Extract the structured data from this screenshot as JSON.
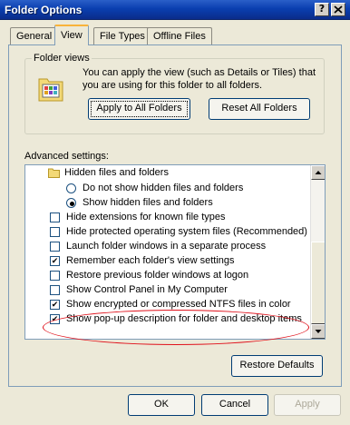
{
  "window": {
    "title": "Folder Options",
    "help_button": "?",
    "close_button": "X"
  },
  "tabs": [
    {
      "label": "General",
      "active": false
    },
    {
      "label": "View",
      "active": true
    },
    {
      "label": "File Types",
      "active": false
    },
    {
      "label": "Offline Files",
      "active": false
    }
  ],
  "folder_views": {
    "legend": "Folder views",
    "description": "You can apply the view (such as Details or Tiles) that you are using for this folder to all folders.",
    "apply_button": "Apply to All Folders",
    "reset_button": "Reset All Folders"
  },
  "advanced": {
    "label": "Advanced settings:",
    "items": [
      {
        "type": "folder",
        "label": "Hidden files and folders"
      },
      {
        "type": "radio",
        "label": "Do not show hidden files and folders",
        "checked": false
      },
      {
        "type": "radio",
        "label": "Show hidden files and folders",
        "checked": true
      },
      {
        "type": "checkbox",
        "label": "Hide extensions for known file types",
        "checked": false
      },
      {
        "type": "checkbox",
        "label": "Hide protected operating system files (Recommended)",
        "checked": false
      },
      {
        "type": "checkbox",
        "label": "Launch folder windows in a separate process",
        "checked": false
      },
      {
        "type": "checkbox",
        "label": "Remember each folder's view settings",
        "checked": true
      },
      {
        "type": "checkbox",
        "label": "Restore previous folder windows at logon",
        "checked": false
      },
      {
        "type": "checkbox",
        "label": "Show Control Panel in My Computer",
        "checked": false
      },
      {
        "type": "checkbox",
        "label": "Show encrypted or compressed NTFS files in color",
        "checked": true
      },
      {
        "type": "checkbox",
        "label": "Show pop-up description for folder and desktop items",
        "checked": true
      }
    ],
    "restore_button": "Restore Defaults"
  },
  "footer": {
    "ok": "OK",
    "cancel": "Cancel",
    "apply": "Apply"
  },
  "colors": {
    "titlebar": "#0a3fb0",
    "annotation": "#e0101a"
  }
}
